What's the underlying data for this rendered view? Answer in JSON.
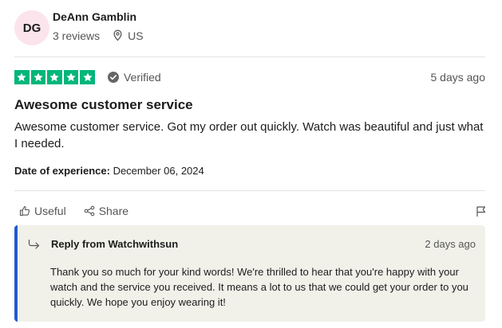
{
  "reviewer": {
    "initials": "DG",
    "name": "DeAnn Gamblin",
    "reviews": "3 reviews",
    "location": "US"
  },
  "rating": {
    "stars": 5,
    "max": 5,
    "verified_label": "Verified",
    "posted": "5 days ago"
  },
  "review": {
    "title": "Awesome customer service",
    "body": "Awesome customer service. Got my order out quickly. Watch was beautiful and just what I needed.",
    "experience_label": "Date of experience:",
    "experience_date": "December 06, 2024"
  },
  "actions": {
    "useful": "Useful",
    "share": "Share"
  },
  "reply": {
    "from": "Reply from Watchwithsun",
    "posted": "2 days ago",
    "body": "Thank you so much for your kind words! We're thrilled to hear that you're happy with your watch and the service you received. It means a lot to us that we could get your order to you quickly. We hope you enjoy wearing it!"
  },
  "colors": {
    "star_green": "#00b67a",
    "avatar_bg": "#fce4ec",
    "reply_accent": "#1f5bd1",
    "reply_bg": "#f1f1ea"
  }
}
